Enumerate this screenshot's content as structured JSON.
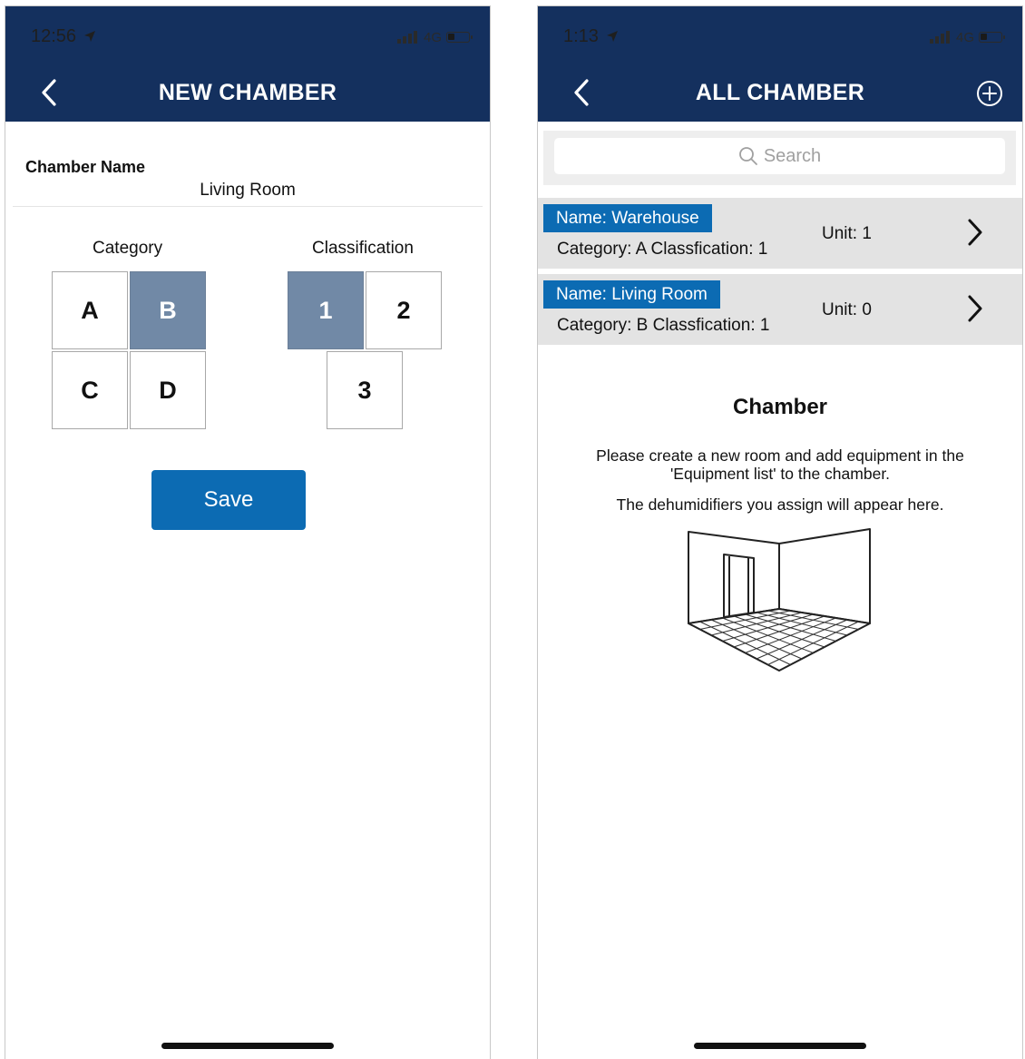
{
  "left": {
    "status": {
      "time": "12:56",
      "network": "4G"
    },
    "header": {
      "title": "NEW CHAMBER"
    },
    "form": {
      "chamber_name_label": "Chamber Name",
      "chamber_name_value": "Living Room",
      "category_title": "Category",
      "classification_title": "Classification",
      "categories": [
        "A",
        "B",
        "C",
        "D"
      ],
      "selected_category": "B",
      "classifications": [
        "1",
        "2",
        "3"
      ],
      "selected_classification": "1",
      "save_label": "Save"
    }
  },
  "right": {
    "status": {
      "time": "1:13",
      "network": "4G"
    },
    "header": {
      "title": "ALL CHAMBER"
    },
    "search": {
      "placeholder": "Search"
    },
    "chambers": [
      {
        "name": "Name: Warehouse",
        "details": "Category: A Classfication: 1",
        "unit": "Unit: 1"
      },
      {
        "name": "Name: Living Room",
        "details": "Category: B Classfication: 1",
        "unit": "Unit: 0"
      }
    ],
    "empty_state": {
      "title": "Chamber",
      "line1": "Please create a new room and add equipment in the",
      "line2": "'Equipment list' to the chamber.",
      "line3": "The dehumidifiers you assign will appear here."
    }
  },
  "colors": {
    "header_bg": "#14305e",
    "accent_blue": "#0c6bb3",
    "selected_cell": "#7189a6",
    "row_bg": "#e3e3e3"
  },
  "icons": [
    "back-chevron-icon",
    "location-arrow-icon",
    "signal-bars-icon",
    "battery-icon",
    "plus-circle-icon",
    "search-icon",
    "chevron-right-icon",
    "room-illustration"
  ]
}
